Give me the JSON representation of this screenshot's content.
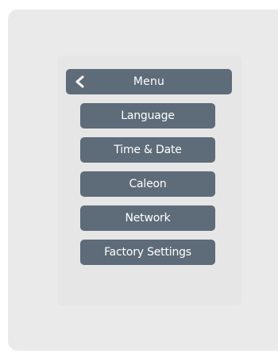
{
  "header": {
    "title": "Menu",
    "back_icon": "chevron-left-icon"
  },
  "menu": {
    "items": [
      {
        "label": "Language"
      },
      {
        "label": "Time & Date"
      },
      {
        "label": "Caleon"
      },
      {
        "label": "Network"
      },
      {
        "label": "Factory Settings"
      }
    ]
  },
  "colors": {
    "button_bg": "#5e6b79",
    "button_text": "#ffffff",
    "panel_bg": "#eaeaea"
  }
}
